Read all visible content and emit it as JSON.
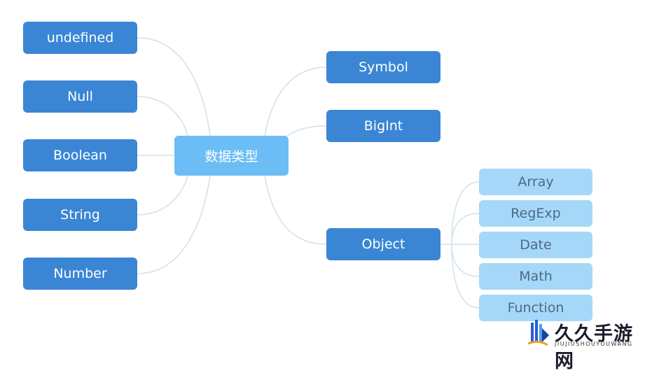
{
  "center": {
    "label": "数据类型"
  },
  "left_nodes": [
    {
      "label": "undefined"
    },
    {
      "label": "Null"
    },
    {
      "label": "Boolean"
    },
    {
      "label": "String"
    },
    {
      "label": "Number"
    }
  ],
  "right_nodes": [
    {
      "label": "Symbol"
    },
    {
      "label": "BigInt"
    },
    {
      "label": "Object"
    }
  ],
  "object_children": [
    {
      "label": "Array"
    },
    {
      "label": "RegExp"
    },
    {
      "label": "Date"
    },
    {
      "label": "Math"
    },
    {
      "label": "Function"
    }
  ],
  "watermark": {
    "title": "久久手游网",
    "subtitle": "JIUJIUSHOUYOUWANG"
  },
  "colors": {
    "primary": "#3a86d4",
    "center": "#6cbdf5",
    "sub": "#a5d8f8",
    "connector": "#cfe2ea"
  }
}
